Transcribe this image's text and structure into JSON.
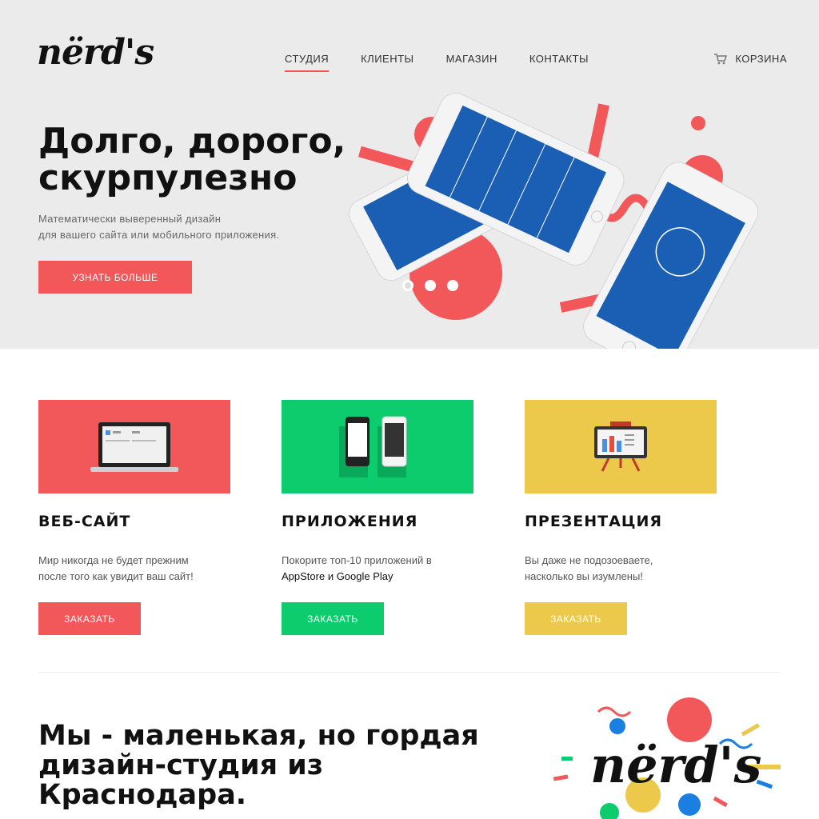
{
  "brand": {
    "logo_text": "nërd's"
  },
  "nav": {
    "items": [
      {
        "label": "СТУДИЯ",
        "active": true
      },
      {
        "label": "КЛИЕНТЫ",
        "active": false
      },
      {
        "label": "МАГАЗИН",
        "active": false
      },
      {
        "label": "КОНТАКТЫ",
        "active": false
      }
    ],
    "cart_label": "КОРЗИНА",
    "cart_icon": "cart-icon"
  },
  "hero": {
    "title_line1": "Долго, дорого,",
    "title_line2": "скурпулезно",
    "subtitle_line1": "Математически выверенный дизайн",
    "subtitle_line2": "для вашего сайта или мобильного приложения.",
    "button_label": "УЗНАТЬ БОЛЬШЕ",
    "slider_active_index": 0,
    "slider_count": 3
  },
  "services": [
    {
      "title": "ВЕБ-САЙТ",
      "text_line1": "Мир никогда не будет прежним",
      "text_line2": "после того как увидит ваш сайт!",
      "button_label": "ЗАКАЗАТЬ",
      "color": "#f2575a",
      "icon": "laptop-icon"
    },
    {
      "title": "ПРИЛОЖЕНИЯ",
      "text_line1": "Покорите топ-10 приложений в",
      "text_line2": "AppStore и Google Play",
      "button_label": "ЗАКАЗАТЬ",
      "color": "#0dcc6e",
      "icon": "phones-icon"
    },
    {
      "title": "ПРЕЗЕНТАЦИЯ",
      "text_line1": "Вы даже не подозоеваете,",
      "text_line2": "насколько вы изумлены!",
      "button_label": "ЗАКАЗАТЬ",
      "color": "#ecc94a",
      "icon": "presentation-board-icon"
    }
  ],
  "about": {
    "line1": "Мы - маленькая, но гордая",
    "line2": "дизайн-студия из",
    "line3": "Краснодара."
  },
  "colors": {
    "accent": "#f2575a",
    "blue": "#1a5fb4",
    "green": "#0dcc6e",
    "yellow": "#ecc94a"
  }
}
